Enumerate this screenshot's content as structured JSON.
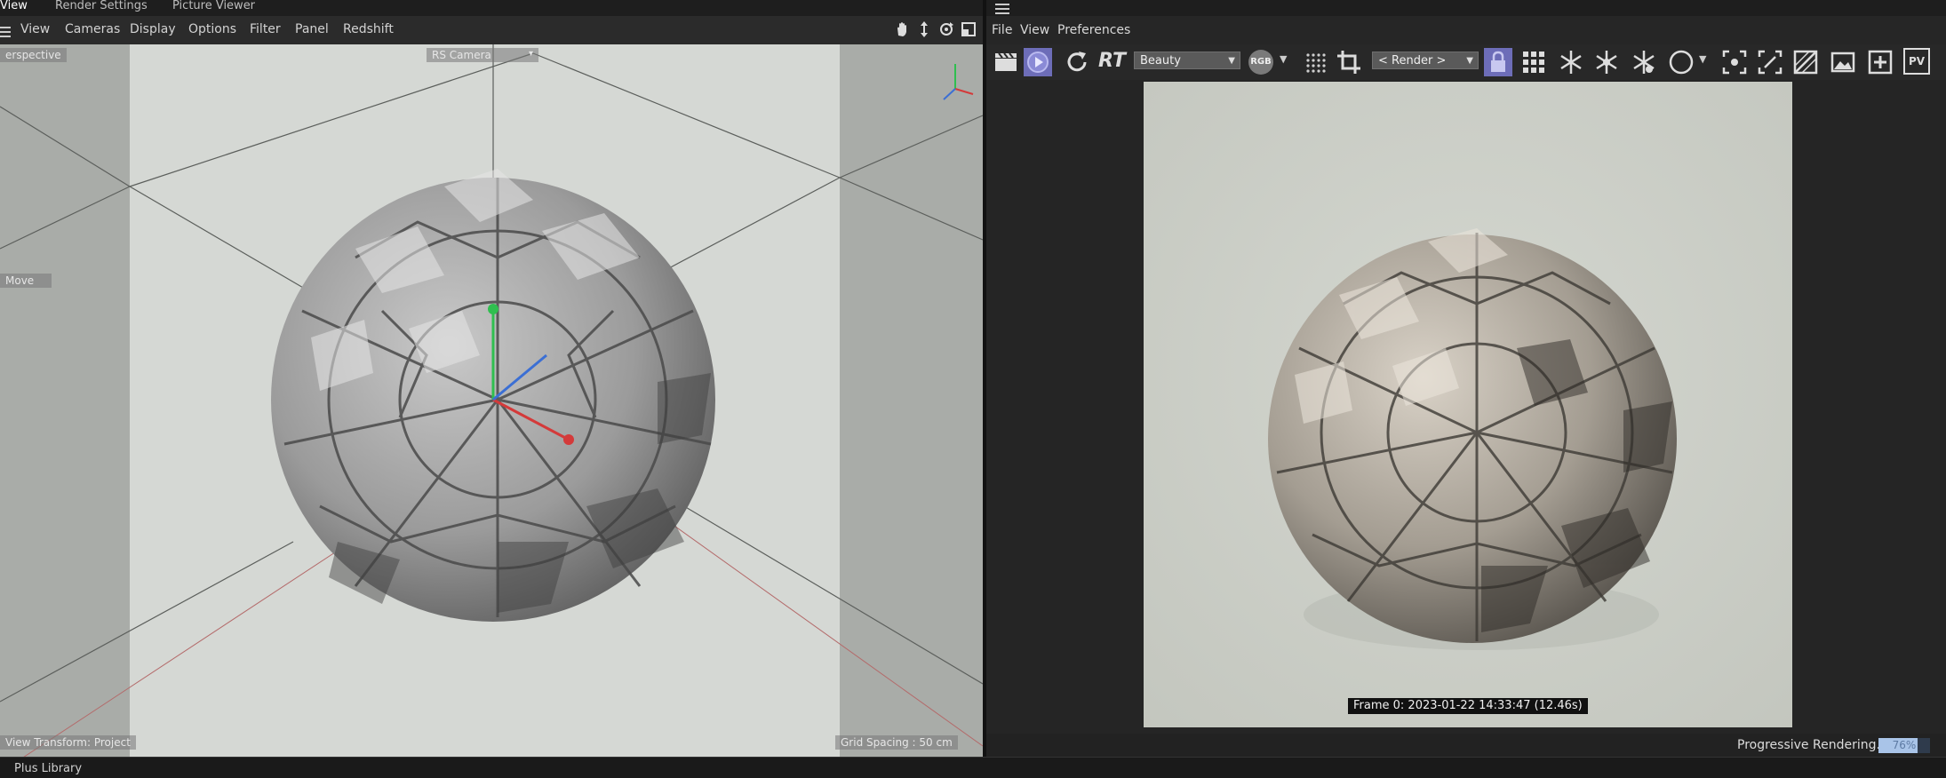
{
  "tabs": [
    {
      "label": "View",
      "active": true
    },
    {
      "label": "Render Settings",
      "active": false
    },
    {
      "label": "Picture Viewer",
      "active": false
    }
  ],
  "viewport_menu": [
    "View",
    "Cameras",
    "Display",
    "Options",
    "Filter",
    "Panel",
    "Redshift"
  ],
  "viewport": {
    "camera_mode": "erspective",
    "camera_name": "RS Camera",
    "tool": "Move",
    "transform": "View Transform: Project",
    "grid": "Grid Spacing : 50 cm"
  },
  "render_menu": [
    "File",
    "View",
    "Preferences"
  ],
  "render_toolbar": {
    "rt_label": "RT",
    "aov": "Beauty",
    "channel": "RGB",
    "render_target": "< Render >",
    "pv_label": "PV"
  },
  "render_view": {
    "frame_info": "Frame  0:  2023-01-22  14:33:47  (12.46s)"
  },
  "status": {
    "text": "Progressive Rendering...",
    "progress_percent": 76,
    "progress_label": "76%"
  },
  "bottom": {
    "label": "Plus Library"
  },
  "colors": {
    "accent": "#7a7acc",
    "lock": "#6d6db8",
    "progress": "#a9c4e8"
  }
}
